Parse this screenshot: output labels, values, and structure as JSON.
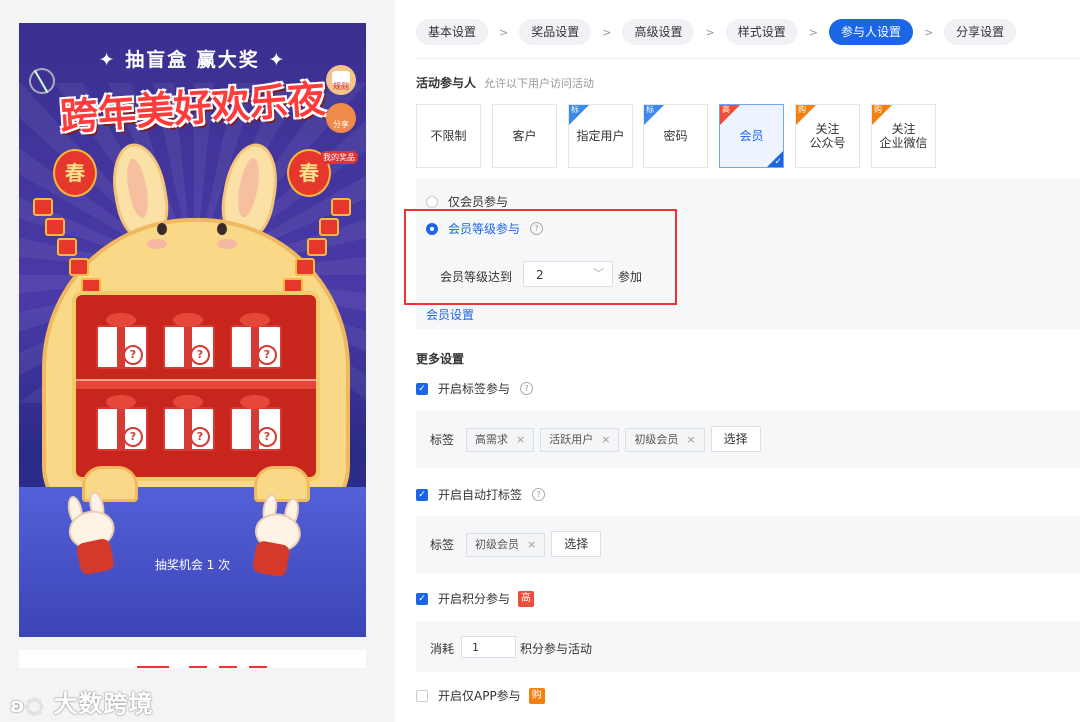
{
  "preview": {
    "slogan": "✦ 抽盲盒  赢大奖 ✦",
    "headline": "跨年美好欢乐夜",
    "rules_label": "规则",
    "share_label": "分享",
    "my_prize_label": "我的奖品",
    "lantern_left": "春",
    "lantern_right": "春",
    "chance_text": "抽奖机会 1 次"
  },
  "watermark": "大数跨境",
  "steps": [
    {
      "label": "基本设置"
    },
    {
      "label": "奖品设置"
    },
    {
      "label": "高级设置"
    },
    {
      "label": "样式设置"
    },
    {
      "label": "参与人设置"
    },
    {
      "label": "分享设置"
    }
  ],
  "participants": {
    "title": "活动参与人",
    "hint": "允许以下用户访问活动",
    "cards": [
      {
        "label": "不限制",
        "corner": ""
      },
      {
        "label": "客户",
        "corner": ""
      },
      {
        "label": "指定用户",
        "corner": "标"
      },
      {
        "label": "密码",
        "corner": "标"
      },
      {
        "label": "会员",
        "corner": "高"
      },
      {
        "label": "关注\n公众号",
        "corner": "购"
      },
      {
        "label": "关注\n企业微信",
        "corner": "购"
      }
    ],
    "selected_check": "✓",
    "radio_members_only": "仅会员参与",
    "radio_member_level": "会员等级参与",
    "level_prefix": "会员等级达到",
    "level_value": "2",
    "level_suffix": "参加",
    "member_settings_link": "会员设置"
  },
  "more": {
    "title": "更多设置",
    "tag_participation": {
      "label": "开启标签参与",
      "row_label": "标签",
      "tags": [
        "高需求",
        "活跃用户",
        "初级会员"
      ],
      "select_button": "选择"
    },
    "auto_tag": {
      "label": "开启自动打标签",
      "row_label": "标签",
      "tags": [
        "初级会员"
      ],
      "select_button": "选择"
    },
    "points": {
      "label": "开启积分参与",
      "badge": "高",
      "consume_label": "消耗",
      "consume_value": "1",
      "consume_suffix": "积分参与活动"
    },
    "app_only": {
      "label": "开启仅APP参与",
      "badge": "购"
    }
  },
  "colors": {
    "accent": "#1b66e6",
    "badge_red": "#ee4d3a",
    "badge_orange": "#f2800f",
    "badge_blue": "#3c8be9",
    "highlight_box": "#e33333"
  }
}
